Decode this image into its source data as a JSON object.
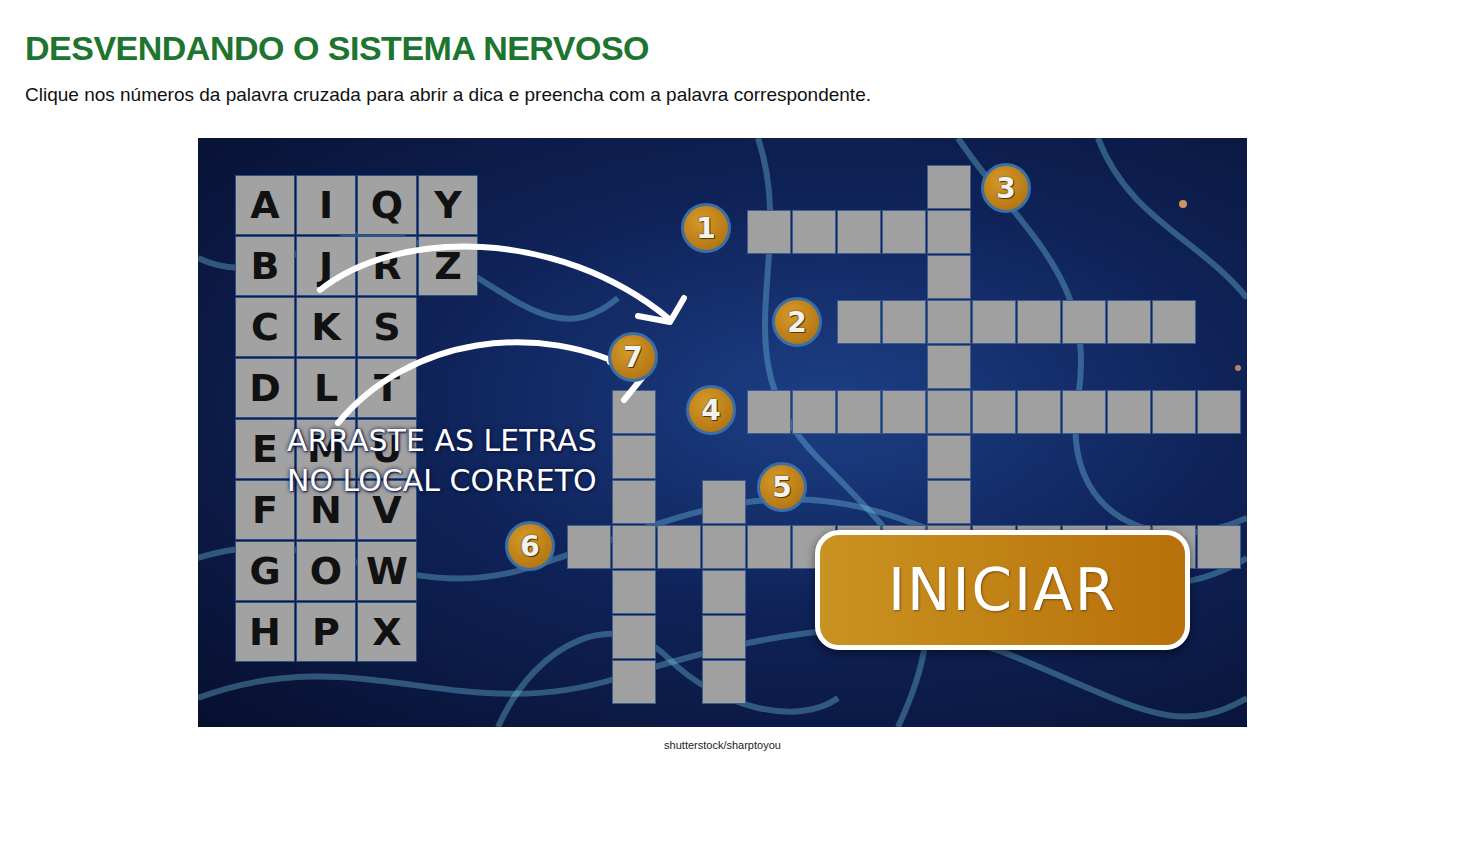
{
  "page": {
    "title": "DESVENDANDO O SISTEMA NERVOSO",
    "instructions": "Clique nos números da palavra cruzada para abrir a dica e preencha com a palavra correspondente."
  },
  "game": {
    "letters": [
      [
        "A",
        "B",
        "C",
        "D",
        "E",
        "F",
        "G",
        "H"
      ],
      [
        "I",
        "J",
        "K",
        "L",
        "M",
        "N",
        "O",
        "P"
      ],
      [
        "Q",
        "R",
        "S",
        "T",
        "U",
        "V",
        "W",
        "X"
      ],
      [
        "Y",
        "Z"
      ]
    ],
    "clues": [
      {
        "number": "1",
        "length": 5
      },
      {
        "number": "2",
        "length": 8
      },
      {
        "number": "3",
        "length": 9
      },
      {
        "number": "4",
        "length": 11
      },
      {
        "number": "5",
        "length": 5
      },
      {
        "number": "6",
        "length": 15
      },
      {
        "number": "7",
        "length": 7
      }
    ],
    "hint": [
      "ARRASTE AS LETRAS",
      "NO LOCAL CORRETO"
    ],
    "start_button": "INICIAR"
  },
  "credit": "shutterstock/sharptoyou"
}
